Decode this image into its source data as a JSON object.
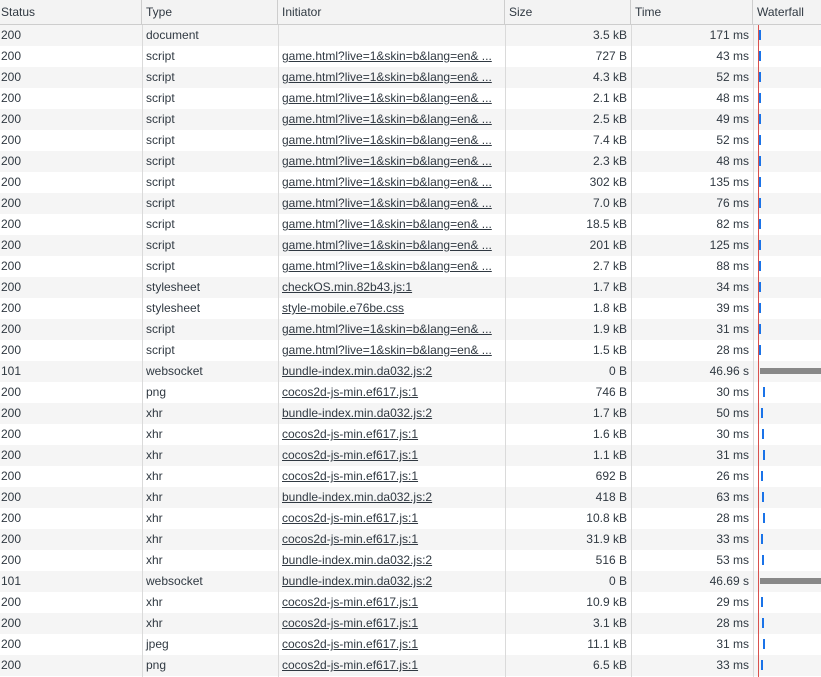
{
  "columns": {
    "status": "Status",
    "type": "Type",
    "initiator": "Initiator",
    "size": "Size",
    "time": "Time",
    "waterfall": "Waterfall"
  },
  "colors": {
    "waterfall_bar": "#1a73e8",
    "waterfall_websocket": "#888888",
    "load_line": "#d9534f"
  },
  "rows": [
    {
      "status": "200",
      "type": "document",
      "initiator": "",
      "size": "3.5 kB",
      "time": "171 ms",
      "kind": "short"
    },
    {
      "status": "200",
      "type": "script",
      "initiator": "game.html?live=1&skin=b&lang=en& ...",
      "size": "727 B",
      "time": "43 ms",
      "kind": "short"
    },
    {
      "status": "200",
      "type": "script",
      "initiator": "game.html?live=1&skin=b&lang=en& ...",
      "size": "4.3 kB",
      "time": "52 ms",
      "kind": "short"
    },
    {
      "status": "200",
      "type": "script",
      "initiator": "game.html?live=1&skin=b&lang=en& ...",
      "size": "2.1 kB",
      "time": "48 ms",
      "kind": "short"
    },
    {
      "status": "200",
      "type": "script",
      "initiator": "game.html?live=1&skin=b&lang=en& ...",
      "size": "2.5 kB",
      "time": "49 ms",
      "kind": "short"
    },
    {
      "status": "200",
      "type": "script",
      "initiator": "game.html?live=1&skin=b&lang=en& ...",
      "size": "7.4 kB",
      "time": "52 ms",
      "kind": "short"
    },
    {
      "status": "200",
      "type": "script",
      "initiator": "game.html?live=1&skin=b&lang=en& ...",
      "size": "2.3 kB",
      "time": "48 ms",
      "kind": "short"
    },
    {
      "status": "200",
      "type": "script",
      "initiator": "game.html?live=1&skin=b&lang=en& ...",
      "size": "302 kB",
      "time": "135 ms",
      "kind": "short"
    },
    {
      "status": "200",
      "type": "script",
      "initiator": "game.html?live=1&skin=b&lang=en& ...",
      "size": "7.0 kB",
      "time": "76 ms",
      "kind": "short"
    },
    {
      "status": "200",
      "type": "script",
      "initiator": "game.html?live=1&skin=b&lang=en& ...",
      "size": "18.5 kB",
      "time": "82 ms",
      "kind": "short"
    },
    {
      "status": "200",
      "type": "script",
      "initiator": "game.html?live=1&skin=b&lang=en& ...",
      "size": "201 kB",
      "time": "125 ms",
      "kind": "short"
    },
    {
      "status": "200",
      "type": "script",
      "initiator": "game.html?live=1&skin=b&lang=en& ...",
      "size": "2.7 kB",
      "time": "88 ms",
      "kind": "short"
    },
    {
      "status": "200",
      "type": "stylesheet",
      "initiator": "checkOS.min.82b43.js:1",
      "size": "1.7 kB",
      "time": "34 ms",
      "kind": "short"
    },
    {
      "status": "200",
      "type": "stylesheet",
      "initiator": "style-mobile.e76be.css",
      "size": "1.8 kB",
      "time": "39 ms",
      "kind": "short"
    },
    {
      "status": "200",
      "type": "script",
      "initiator": "game.html?live=1&skin=b&lang=en& ...",
      "size": "1.9 kB",
      "time": "31 ms",
      "kind": "short"
    },
    {
      "status": "200",
      "type": "script",
      "initiator": "game.html?live=1&skin=b&lang=en& ...",
      "size": "1.5 kB",
      "time": "28 ms",
      "kind": "short"
    },
    {
      "status": "101",
      "type": "websocket",
      "initiator": "bundle-index.min.da032.js:2",
      "size": "0 B",
      "time": "46.96 s",
      "kind": "long"
    },
    {
      "status": "200",
      "type": "png",
      "initiator": "cocos2d-js-min.ef617.js:1",
      "size": "746 B",
      "time": "30 ms",
      "kind": "short"
    },
    {
      "status": "200",
      "type": "xhr",
      "initiator": "bundle-index.min.da032.js:2",
      "size": "1.7 kB",
      "time": "50 ms",
      "kind": "short"
    },
    {
      "status": "200",
      "type": "xhr",
      "initiator": "cocos2d-js-min.ef617.js:1",
      "size": "1.6 kB",
      "time": "30 ms",
      "kind": "short"
    },
    {
      "status": "200",
      "type": "xhr",
      "initiator": "cocos2d-js-min.ef617.js:1",
      "size": "1.1 kB",
      "time": "31 ms",
      "kind": "short"
    },
    {
      "status": "200",
      "type": "xhr",
      "initiator": "cocos2d-js-min.ef617.js:1",
      "size": "692 B",
      "time": "26 ms",
      "kind": "short"
    },
    {
      "status": "200",
      "type": "xhr",
      "initiator": "bundle-index.min.da032.js:2",
      "size": "418 B",
      "time": "63 ms",
      "kind": "short"
    },
    {
      "status": "200",
      "type": "xhr",
      "initiator": "cocos2d-js-min.ef617.js:1",
      "size": "10.8 kB",
      "time": "28 ms",
      "kind": "short"
    },
    {
      "status": "200",
      "type": "xhr",
      "initiator": "cocos2d-js-min.ef617.js:1",
      "size": "31.9 kB",
      "time": "33 ms",
      "kind": "short"
    },
    {
      "status": "200",
      "type": "xhr",
      "initiator": "bundle-index.min.da032.js:2",
      "size": "516 B",
      "time": "53 ms",
      "kind": "short"
    },
    {
      "status": "101",
      "type": "websocket",
      "initiator": "bundle-index.min.da032.js:2",
      "size": "0 B",
      "time": "46.69 s",
      "kind": "long"
    },
    {
      "status": "200",
      "type": "xhr",
      "initiator": "cocos2d-js-min.ef617.js:1",
      "size": "10.9 kB",
      "time": "29 ms",
      "kind": "short"
    },
    {
      "status": "200",
      "type": "xhr",
      "initiator": "cocos2d-js-min.ef617.js:1",
      "size": "3.1 kB",
      "time": "28 ms",
      "kind": "short"
    },
    {
      "status": "200",
      "type": "jpeg",
      "initiator": "cocos2d-js-min.ef617.js:1",
      "size": "11.1 kB",
      "time": "31 ms",
      "kind": "short"
    },
    {
      "status": "200",
      "type": "png",
      "initiator": "cocos2d-js-min.ef617.js:1",
      "size": "6.5 kB",
      "time": "33 ms",
      "kind": "short"
    }
  ]
}
